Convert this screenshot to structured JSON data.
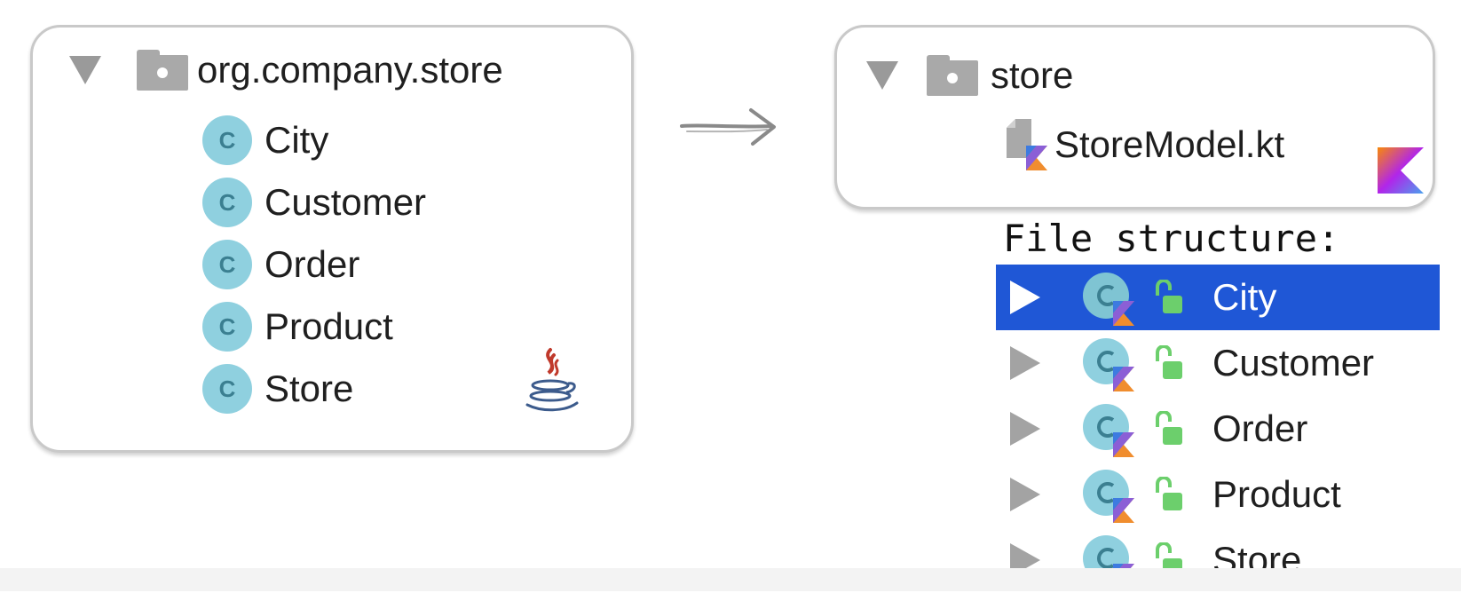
{
  "java_panel": {
    "package_name": "org.company.store",
    "classes": [
      {
        "icon_letter": "C",
        "name": "City"
      },
      {
        "icon_letter": "C",
        "name": "Customer"
      },
      {
        "icon_letter": "C",
        "name": "Order"
      },
      {
        "icon_letter": "C",
        "name": "Product"
      },
      {
        "icon_letter": "C",
        "name": "Store"
      }
    ],
    "logo_icon": "java-logo-icon"
  },
  "kotlin_panel": {
    "package_name": "store",
    "file_name": "StoreModel.kt",
    "logo_icon": "kotlin-logo-icon"
  },
  "file_structure": {
    "title": "File structure:",
    "items": [
      {
        "name": "City",
        "selected": true
      },
      {
        "name": "Customer",
        "selected": false
      },
      {
        "name": "Order",
        "selected": false
      },
      {
        "name": "Product",
        "selected": false
      },
      {
        "name": "Store",
        "selected": false
      }
    ]
  },
  "colors": {
    "selection": "#1f57d6",
    "class_icon": "#8fd0df",
    "lock": "#6ccf6c"
  }
}
